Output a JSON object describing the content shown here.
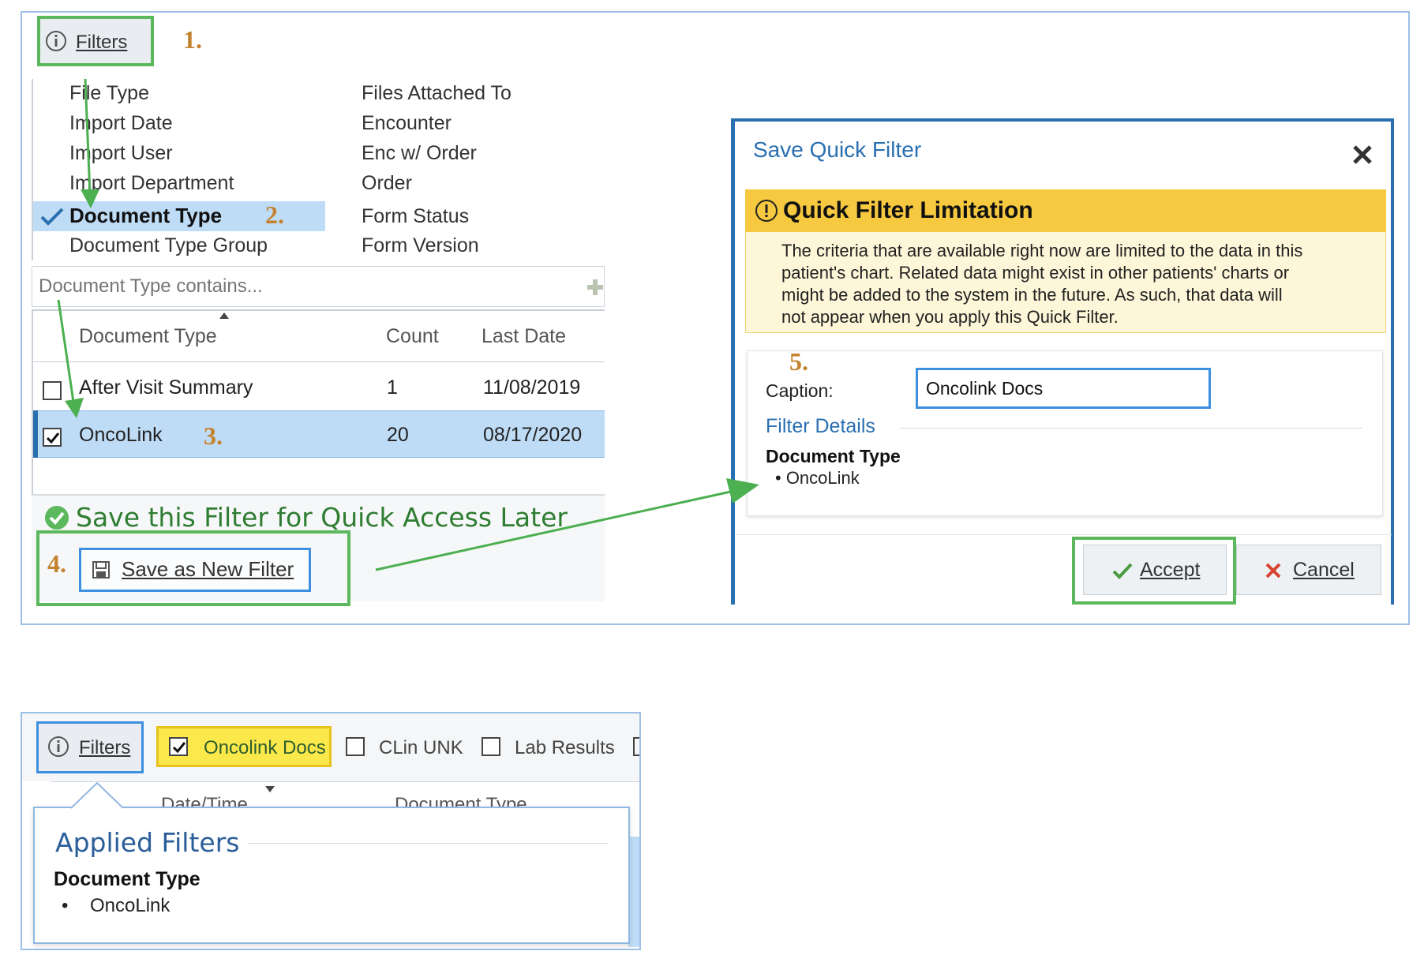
{
  "filters_button": {
    "label": "Filters"
  },
  "steps": {
    "s1": "1.",
    "s2": "2.",
    "s3": "3.",
    "s4": "4.",
    "s5": "5."
  },
  "criteria": {
    "left": [
      "File Type",
      "Import Date",
      "Import User",
      "Import Department",
      "Document Type",
      "Document Type Group"
    ],
    "right": [
      "Files Attached To",
      "Encounter",
      "Enc w/ Order",
      "Order",
      "Form Status",
      "Form Version"
    ],
    "selected": "Document Type"
  },
  "search": {
    "placeholder": "Document Type contains..."
  },
  "table": {
    "headers": {
      "type": "Document Type",
      "count": "Count",
      "date": "Last Date"
    },
    "rows": [
      {
        "type": "After Visit Summary",
        "count": "1",
        "date": "11/08/2019",
        "checked": false
      },
      {
        "type": "OncoLink",
        "count": "20",
        "date": "08/17/2020",
        "checked": true
      }
    ]
  },
  "save_section": {
    "title": "Save this Filter for Quick Access Later",
    "button": "Save as New Filter"
  },
  "dialog": {
    "title": "Save Quick Filter",
    "warning_title": "Quick Filter Limitation",
    "warning_lines": [
      "The criteria that are available right now are limited to the data in this",
      "patient's chart. Related data might exist in other patients' charts or",
      "might be added to the system in the future. As such, that data will",
      "not appear when you apply this Quick Filter."
    ],
    "caption_label": "Caption:",
    "caption_value": "Oncolink Docs",
    "details_label": "Filter Details",
    "details_heading": "Document Type",
    "details_item": "• OncoLink",
    "accept": "Accept",
    "cancel": "Cancel"
  },
  "bottom": {
    "filters": "Filters",
    "quick_filters": [
      {
        "label": "Oncolink Docs",
        "checked": true
      },
      {
        "label": "CLin UNK",
        "checked": false
      },
      {
        "label": "Lab Results",
        "checked": false
      }
    ],
    "col_date": "Date/Time",
    "col_type": "Document Type",
    "applied_title": "Applied Filters",
    "applied_heading": "Document Type",
    "applied_bullet": "•",
    "applied_item": "OncoLink"
  },
  "colors": {
    "green": "#5cb85c",
    "blue": "#3d8fe0",
    "step": "#c4822e",
    "warn": "#f7c940",
    "selected": "#bfdcf6"
  }
}
